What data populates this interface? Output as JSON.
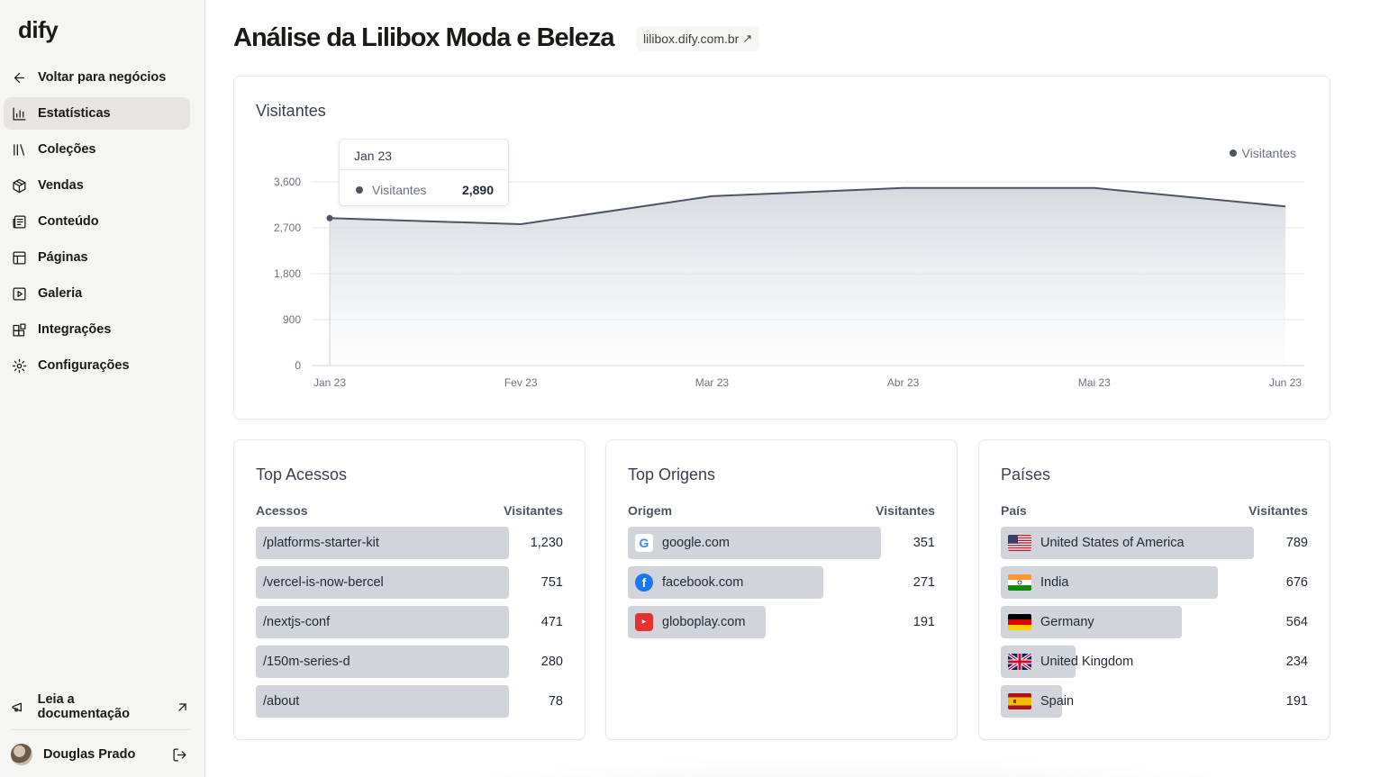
{
  "sidebar": {
    "logo": "dify",
    "back": "Voltar para negócios",
    "items": [
      {
        "label": "Estatísticas",
        "icon": "bar-chart-icon",
        "active": true
      },
      {
        "label": "Coleções",
        "icon": "library-icon"
      },
      {
        "label": "Vendas",
        "icon": "package-icon"
      },
      {
        "label": "Conteúdo",
        "icon": "newspaper-icon"
      },
      {
        "label": "Páginas",
        "icon": "layout-icon"
      },
      {
        "label": "Galeria",
        "icon": "play-square-icon"
      },
      {
        "label": "Integrações",
        "icon": "blocks-icon"
      },
      {
        "label": "Configurações",
        "icon": "settings-icon"
      }
    ],
    "docs": "Leia a documentação",
    "user": "Douglas Prado"
  },
  "header": {
    "title": "Análise da Lilibox Moda e Beleza",
    "site": "lilibox.dify.com.br"
  },
  "chart_card": {
    "title": "Visitantes",
    "legend": "Visitantes",
    "tooltip": {
      "date": "Jan 23",
      "label": "Visitantes",
      "value": "2,890"
    }
  },
  "chart_data": {
    "type": "area",
    "categories": [
      "Jan 23",
      "Fev 23",
      "Mar 23",
      "Abr 23",
      "Mai 23",
      "Jun 23"
    ],
    "series": [
      {
        "name": "Visitantes",
        "values": [
          2890,
          2770,
          3320,
          3480,
          3480,
          3120
        ]
      }
    ],
    "ylim": [
      0,
      3600
    ],
    "yticks": [
      "0",
      "900",
      "1,800",
      "2,700",
      "3,600"
    ],
    "grid": true,
    "legend_position": "top-right",
    "color": "#4b5563"
  },
  "top_acessos": {
    "title": "Top Acessos",
    "col1": "Acessos",
    "col2": "Visitantes",
    "rows": [
      {
        "label": "/platforms-starter-kit",
        "value": "1,230",
        "fraction": 1.0
      },
      {
        "label": "/vercel-is-now-bercel",
        "value": "751",
        "fraction": 1.0
      },
      {
        "label": "/nextjs-conf",
        "value": "471",
        "fraction": 1.0
      },
      {
        "label": "/150m-series-d",
        "value": "280",
        "fraction": 1.0
      },
      {
        "label": "/about",
        "value": "78",
        "fraction": 1.0
      }
    ]
  },
  "top_origens": {
    "title": "Top Origens",
    "col1": "Origem",
    "col2": "Visitantes",
    "rows": [
      {
        "label": "google.com",
        "value": "351",
        "fraction": 1.0,
        "icon": "google-icon"
      },
      {
        "label": "facebook.com",
        "value": "271",
        "fraction": 0.772,
        "icon": "facebook-icon"
      },
      {
        "label": "globoplay.com",
        "value": "191",
        "fraction": 0.544,
        "icon": "globoplay-icon"
      }
    ]
  },
  "paises": {
    "title": "Países",
    "col1": "País",
    "col2": "Visitantes",
    "rows": [
      {
        "label": "United States of America",
        "value": "789",
        "fraction": 1.0,
        "icon": "us-flag-icon"
      },
      {
        "label": "India",
        "value": "676",
        "fraction": 0.857,
        "icon": "india-flag-icon"
      },
      {
        "label": "Germany",
        "value": "564",
        "fraction": 0.715,
        "icon": "germany-flag-icon"
      },
      {
        "label": "United Kingdom",
        "value": "234",
        "fraction": 0.297,
        "icon": "uk-flag-icon"
      },
      {
        "label": "Spain",
        "value": "191",
        "fraction": 0.242,
        "icon": "spain-flag-icon"
      }
    ]
  }
}
